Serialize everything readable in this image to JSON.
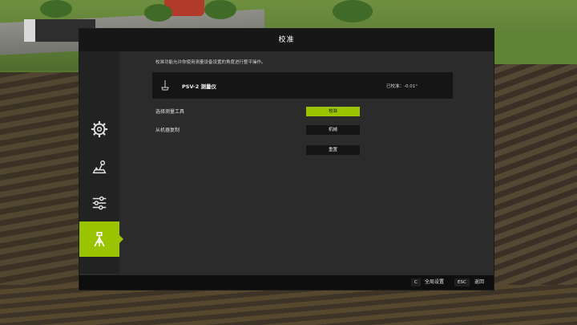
{
  "dialog": {
    "title": "校准",
    "description": "校准功能允许你使用测量设备设置的角度进行整平操作。"
  },
  "sidebar": {
    "items": [
      {
        "icon": "gear-icon",
        "active": false
      },
      {
        "icon": "joystick-icon",
        "active": false
      },
      {
        "icon": "sliders-icon",
        "active": false
      },
      {
        "icon": "survey-tripod-icon",
        "active": true
      }
    ]
  },
  "tool": {
    "icon": "survey-tripod-icon",
    "name": "PSV-2 测量仪",
    "status": "已校准：-0.01°"
  },
  "rows": [
    {
      "label": "选择测量工具",
      "button": "校准"
    },
    {
      "label": "从机器复制",
      "button": "机械"
    },
    {
      "label": "",
      "button": "重置"
    }
  ],
  "footer": {
    "global_key": "C",
    "global_label": "全局设置",
    "back_key": "ESC",
    "back_label": "返回"
  },
  "colors": {
    "accent": "#9ac400",
    "panel": "#2b2b2b",
    "bar": "#151515"
  }
}
